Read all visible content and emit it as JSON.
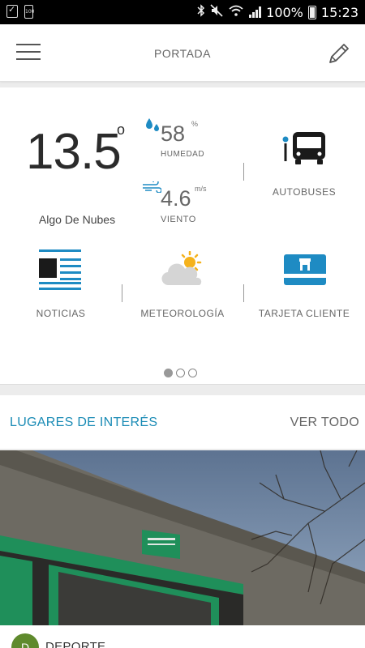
{
  "status_bar": {
    "battery_percent": "100%",
    "time": "15:23",
    "small_battery_label": "100",
    "icons": [
      "image-icon",
      "checklist-icon",
      "battery-saver-icon",
      "bluetooth-icon",
      "mute-icon",
      "wifi-icon",
      "signal-icon",
      "battery-icon"
    ]
  },
  "app_bar": {
    "title": "PORTADA",
    "menu_icon": "hamburger-menu-icon",
    "edit_icon": "pencil-icon"
  },
  "weather": {
    "temperature": "13.5",
    "degree_symbol": "o",
    "description": "Algo De Nubes",
    "humidity_value": "58",
    "humidity_unit": "%",
    "humidity_label": "HUMEDAD",
    "wind_value": "4.6",
    "wind_unit": "m/s",
    "wind_label": "VIENTO"
  },
  "tiles": [
    {
      "label": "AUTOBUSES",
      "icon": "bus-stop-icon"
    },
    {
      "label": "NOTICIAS",
      "icon": "newspaper-icon"
    },
    {
      "label": "METEOROLOGÍA",
      "icon": "partly-cloudy-icon"
    },
    {
      "label": "TARJETA CLIENTE",
      "icon": "client-card-icon"
    }
  ],
  "pager": {
    "pages": 3,
    "active_index": 0
  },
  "interest": {
    "title": "LUGARES DE INTERÉS",
    "view_all": "VER TODO",
    "first_item": {
      "category_initial": "D",
      "category": "DEPORTE"
    }
  },
  "colors": {
    "accent": "#1a8bb5",
    "icon_blue": "#1e8bc3",
    "bus_black": "#1a1a1a",
    "sun_yellow": "#f5b21c",
    "category_green": "#5f8a2d",
    "building_green": "#1f8f5a"
  }
}
